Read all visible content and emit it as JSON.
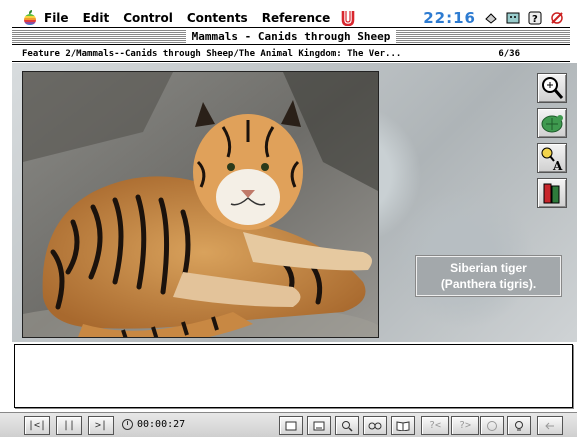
{
  "menubar": {
    "items": [
      "File",
      "Edit",
      "Control",
      "Contents",
      "Reference"
    ],
    "clock": "22:16"
  },
  "title": "Mammals - Canids through Sheep",
  "pathbar": {
    "path": "Feature 2/Mammals--Canids through Sheep/The Animal Kingdom: The Ver...",
    "count": "6/36"
  },
  "caption": {
    "line1": "Siberian tiger",
    "line2": "(Panthera tigris)."
  },
  "tools": [
    "zoom-in-icon",
    "turtle-icon",
    "find-text-icon",
    "books-icon"
  ],
  "bottombar": {
    "timer": "00:00:27",
    "buttons": [
      "|<|",
      "||",
      ">|",
      "?<",
      "?>"
    ]
  },
  "colors": {
    "clock": "#2d7bd1",
    "caption_bg": "#a3a8ab"
  }
}
